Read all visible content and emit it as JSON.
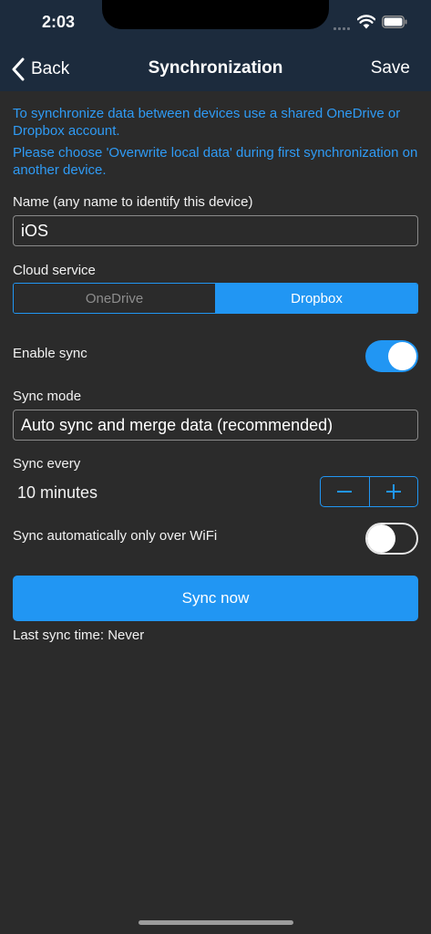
{
  "status": {
    "time": "2:03"
  },
  "nav": {
    "back_label": "Back",
    "title": "Synchronization",
    "save_label": "Save"
  },
  "info": {
    "line1": "To synchronize data between devices use a shared OneDrive or Dropbox account.",
    "line2": "Please choose 'Overwrite local data' during first synchronization on another device."
  },
  "name_field": {
    "label": "Name (any name to identify this device)",
    "value": "iOS"
  },
  "cloud_service": {
    "label": "Cloud service",
    "options": [
      "OneDrive",
      "Dropbox"
    ],
    "selected": "Dropbox"
  },
  "enable_sync": {
    "label": "Enable sync",
    "on": true
  },
  "sync_mode": {
    "label": "Sync mode",
    "value": "Auto sync and merge data (recommended)"
  },
  "sync_every": {
    "label": "Sync every",
    "value": "10 minutes"
  },
  "wifi_only": {
    "label": "Sync automatically only over WiFi",
    "on": false
  },
  "sync_button": {
    "label": "Sync now"
  },
  "last_sync": {
    "text": "Last sync time: Never"
  },
  "colors": {
    "accent": "#2196f3",
    "info_text": "#2f9bf5",
    "header_bg": "#1c2b3d",
    "background": "#2b2b2b"
  },
  "icons": [
    "signal-icon",
    "wifi-icon",
    "battery-icon",
    "chevron-left-icon",
    "minus-icon",
    "plus-icon"
  ]
}
